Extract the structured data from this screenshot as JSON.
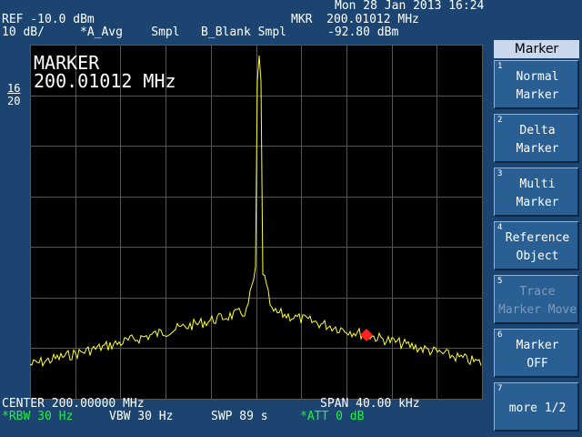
{
  "header": {
    "datetime": "Mon 28 Jan 2013 16:24",
    "ref": "REF -10.0 dBm",
    "scale": "10 dB/",
    "mode": "*A_Avg    Smpl   B_Blank Smpl",
    "mkr_label": "MKR  200.01012 MHz",
    "mkr_level": "-92.80 dBm"
  },
  "screen": {
    "marker_title": "MARKER",
    "marker_freq": "200.01012 MHz",
    "trace_color": "#ffff33",
    "marker_color": "#ff2020",
    "grid_color": "#555555"
  },
  "page": {
    "current": "16",
    "total": "20"
  },
  "footer": {
    "center": "CENTER 200.00000 MHz",
    "span": "SPAN 40.00 kHz",
    "rbw": "*RBW 30 Hz",
    "vbw": "VBW 30 Hz",
    "swp": "SWP 89 s",
    "att": "*ATT 0 dB"
  },
  "softkeys": {
    "title": "Marker",
    "keys": [
      {
        "num": "1",
        "line1": "Normal",
        "line2": "Marker",
        "enabled": true
      },
      {
        "num": "2",
        "line1": "Delta",
        "line2": "Marker",
        "enabled": true
      },
      {
        "num": "3",
        "line1": "Multi",
        "line2": "Marker",
        "enabled": true
      },
      {
        "num": "4",
        "line1": "Reference",
        "line2": "Object",
        "enabled": true
      },
      {
        "num": "5",
        "line1": "Trace",
        "line2": "Marker Move",
        "enabled": false
      },
      {
        "num": "6",
        "line1": "Marker",
        "line2": "OFF",
        "enabled": true
      },
      {
        "num": "7",
        "line1": "more 1/2",
        "line2": "",
        "enabled": true
      }
    ]
  }
}
